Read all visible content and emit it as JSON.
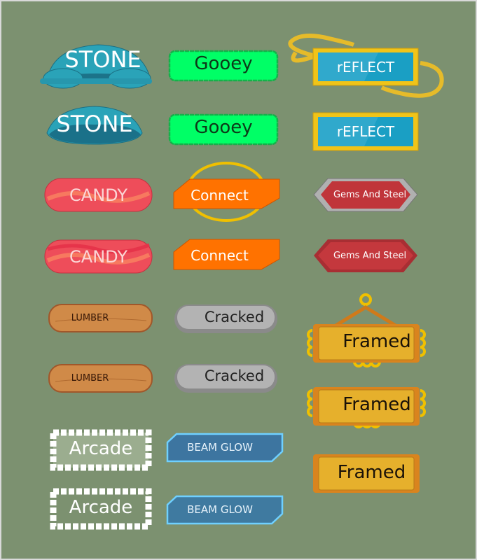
{
  "buttons": {
    "stone": "STONE",
    "gooey": "Gooey",
    "reflect": "rEFLECT",
    "candy": "CANDY",
    "connect": "Connect",
    "gems": "Gems And Steel",
    "lumber": "LUMBER",
    "cracked": "Cracked",
    "framed": "Framed",
    "arcade": "Arcade",
    "beam": "BEAM GLOW"
  },
  "colors": {
    "background": "#7c9170",
    "stone": "#2aa3b8",
    "gooey": "#00ff66",
    "reflect": "#1a9fc4",
    "gold": "#f0c419",
    "candy": "#ee4d5a",
    "connect": "#ff7200",
    "gems": "#c0353a",
    "lumber": "#d08a48",
    "cracked": "#b3b3b3",
    "framed": "#e3a92a",
    "beam": "#3f7aa0"
  }
}
